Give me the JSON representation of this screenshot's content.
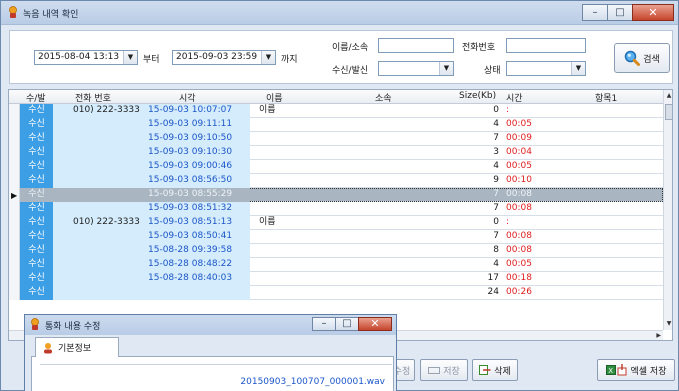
{
  "window": {
    "title": "녹음 내역 확인",
    "minimize": "–",
    "maximize": "□",
    "close": "✕"
  },
  "filter": {
    "date_from": "2015-08-04 13:13",
    "from_suffix": "부터",
    "date_to": "2015-09-03 23:59",
    "to_suffix": "까지",
    "name_label": "이름/소속",
    "name_value": "",
    "phone_label": "전화번호",
    "phone_value": "",
    "direction_label": "수신/발신",
    "direction_value": "",
    "status_label": "상태",
    "status_value": "",
    "search_label": "검색",
    "dropdown_arrow": "▼"
  },
  "grid": {
    "columns": [
      "수/발",
      "전화 번호",
      "시각",
      "이름",
      "소속",
      "Size(Kb)",
      "시간",
      "항목1"
    ],
    "rows": [
      {
        "dir": "수신",
        "phone": "010) 222-3333",
        "time": "15-09-03 10:07:07",
        "name": "이름",
        "size": "0",
        "dur": ":"
      },
      {
        "dir": "수신",
        "phone": "",
        "time": "15-09-03 09:11:11",
        "name": "",
        "size": "4",
        "dur": "00:05"
      },
      {
        "dir": "수신",
        "phone": "",
        "time": "15-09-03 09:10:50",
        "name": "",
        "size": "7",
        "dur": "00:09"
      },
      {
        "dir": "수신",
        "phone": "",
        "time": "15-09-03 09:10:30",
        "name": "",
        "size": "3",
        "dur": "00:04"
      },
      {
        "dir": "수신",
        "phone": "",
        "time": "15-09-03 09:00:46",
        "name": "",
        "size": "4",
        "dur": "00:05"
      },
      {
        "dir": "수신",
        "phone": "",
        "time": "15-09-03 08:56:50",
        "name": "",
        "size": "9",
        "dur": "00:10"
      },
      {
        "dir": "수신",
        "phone": "",
        "time": "15-09-03 08:55:29",
        "name": "",
        "size": "7",
        "dur": "00:08"
      },
      {
        "dir": "수신",
        "phone": "",
        "time": "15-09-03 08:51:32",
        "name": "",
        "size": "7",
        "dur": "00:08"
      },
      {
        "dir": "수신",
        "phone": "010) 222-3333",
        "time": "15-09-03 08:51:13",
        "name": "이름",
        "size": "0",
        "dur": ":"
      },
      {
        "dir": "수신",
        "phone": "",
        "time": "15-09-03 08:50:41",
        "name": "",
        "size": "7",
        "dur": "00:08"
      },
      {
        "dir": "수신",
        "phone": "",
        "time": "15-08-28 09:39:58",
        "name": "",
        "size": "8",
        "dur": "00:08"
      },
      {
        "dir": "수신",
        "phone": "",
        "time": "15-08-28 08:48:22",
        "name": "",
        "size": "4",
        "dur": "00:05"
      },
      {
        "dir": "수신",
        "phone": "",
        "time": "15-08-28 08:40:03",
        "name": "",
        "size": "17",
        "dur": "00:18"
      },
      {
        "dir": "수신",
        "phone": "",
        "time": "",
        "name": "",
        "size": "24",
        "dur": "00:26"
      }
    ]
  },
  "buttons": {
    "edit": "수정",
    "save": "저장",
    "delete": "삭제",
    "excel": "엑셀 저장"
  },
  "dialog": {
    "title": "통화 내용 수정",
    "tab": "기본정보",
    "filename": "20150903_100707_000001.wav"
  },
  "colors": {
    "accent": "#3c9fe6",
    "duration_red": "#e01e1e",
    "time_blue": "#1c56c9"
  }
}
